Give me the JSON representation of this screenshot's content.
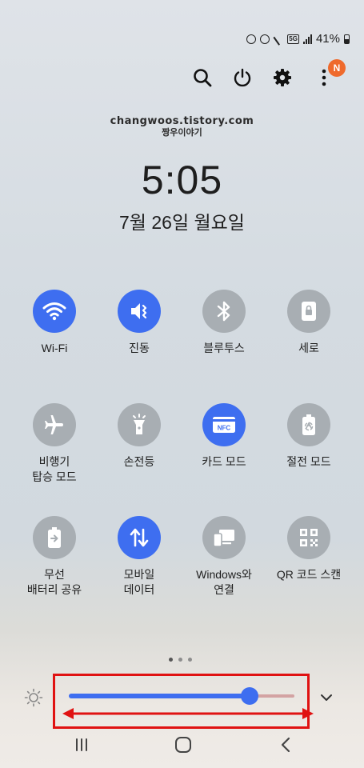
{
  "status_bar": {
    "battery_text": "41%",
    "network_badge": "5G",
    "icons": [
      "clock-icon",
      "alarm-icon",
      "mute-icon",
      "5g-icon",
      "signal-icon",
      "battery-icon"
    ]
  },
  "top_actions": [
    "search-icon",
    "power-icon",
    "settings-icon",
    "more-icon"
  ],
  "notification_badge": "N",
  "watermark": {
    "line1": "changwoos.tistory.com",
    "line2": "짱우이야기"
  },
  "clock": {
    "time": "5:05",
    "date": "7월 26일 월요일"
  },
  "tiles": [
    {
      "label": "Wi-Fi",
      "state": "on",
      "icon": "wifi-icon"
    },
    {
      "label": "진동",
      "state": "on",
      "icon": "vibrate-icon"
    },
    {
      "label": "블루투스",
      "state": "off",
      "icon": "bluetooth-icon"
    },
    {
      "label": "세로",
      "state": "off",
      "icon": "portrait-lock-icon"
    },
    {
      "label": "비행기\n탑승 모드",
      "state": "off",
      "icon": "airplane-icon"
    },
    {
      "label": "손전등",
      "state": "off",
      "icon": "flashlight-icon"
    },
    {
      "label": "카드 모드",
      "state": "on",
      "icon": "nfc-icon",
      "icon_text": "NFC"
    },
    {
      "label": "절전 모드",
      "state": "off",
      "icon": "power-saving-icon"
    },
    {
      "label": "무선\n배터리 공유",
      "state": "off",
      "icon": "wireless-battery-share-icon"
    },
    {
      "label": "모바일\n데이터",
      "state": "on",
      "icon": "mobile-data-icon"
    },
    {
      "label": "Windows와\n연결",
      "state": "off",
      "icon": "link-to-windows-icon"
    },
    {
      "label": "QR 코드 스캔",
      "state": "off",
      "icon": "qr-code-icon"
    }
  ],
  "page_indicator": {
    "count": 3,
    "active": 0
  },
  "brightness": {
    "level": 0.8
  },
  "colors": {
    "accent": "#3e6ef0",
    "tile_off": "#a8aeb3",
    "badge": "#ef6a2c",
    "annotation": "#e01212"
  },
  "nav": [
    "recent-apps-icon",
    "home-icon",
    "back-icon"
  ]
}
